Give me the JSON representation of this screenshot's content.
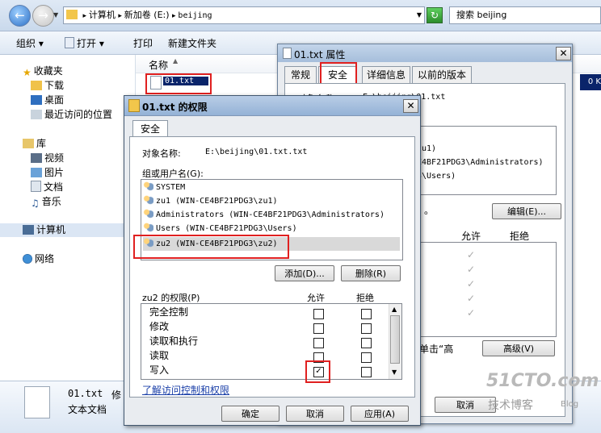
{
  "explorer": {
    "breadcrumb": [
      "计算机",
      "新加卷 (E:)",
      "beijing"
    ],
    "search_placeholder": "搜索 beijing",
    "toolbar": {
      "organize": "组织",
      "open": "打开",
      "print": "打印",
      "new_folder": "新建文件夹"
    },
    "nav": {
      "favorites": "收藏夹",
      "downloads": "下载",
      "desktop": "桌面",
      "recent": "最近访问的位置",
      "libraries": "库",
      "videos": "视频",
      "pictures": "图片",
      "documents": "文档",
      "music": "音乐",
      "computer": "计算机",
      "network": "网络"
    },
    "column_name": "名称",
    "file_name": "01.txt",
    "file_size_partial": "0 K",
    "details": {
      "name": "01.txt",
      "type": "文本文档",
      "extra": "修"
    }
  },
  "properties": {
    "title": "01.txt 属性",
    "tabs": [
      "常规",
      "安全",
      "详细信息",
      "以前的版本"
    ],
    "object_label": "对象名称",
    "object_value": "E:\\beijing\\01.txt",
    "group_fragments": [
      "zu1)",
      "E4BF21PDG3\\Administrators)",
      "3\\Users)"
    ],
    "edit_hint": "。",
    "edit_button": "编辑(E)...",
    "allow": "允许",
    "deny": "拒绝",
    "advanced_hint": "单击“高",
    "advanced_button": "高级(V)",
    "cancel_partial": "取消"
  },
  "permissions": {
    "title": "01.txt 的权限",
    "tab": "安全",
    "object_label": "对象名称:",
    "object_value": "E:\\beijing\\01.txt.txt",
    "group_label": "组或用户名(G):",
    "users": [
      "SYSTEM",
      "zu1 (WIN-CE4BF21PDG3\\zu1)",
      "Administrators (WIN-CE4BF21PDG3\\Administrators)",
      "Users (WIN-CE4BF21PDG3\\Users)",
      "zu2 (WIN-CE4BF21PDG3\\zu2)"
    ],
    "add_button": "添加(D)...",
    "remove_button": "删除(R)",
    "perm_label": "zu2 的权限(P)",
    "allow": "允许",
    "deny": "拒绝",
    "rows": [
      "完全控制",
      "修改",
      "读取和执行",
      "读取",
      "写入"
    ],
    "learn_link": "了解访问控制和权限",
    "ok": "确定",
    "cancel": "取消",
    "apply": "应用(A)"
  },
  "watermark": {
    "site": "51CTO.com",
    "sub": "技术博客",
    "blog": "Blog"
  }
}
